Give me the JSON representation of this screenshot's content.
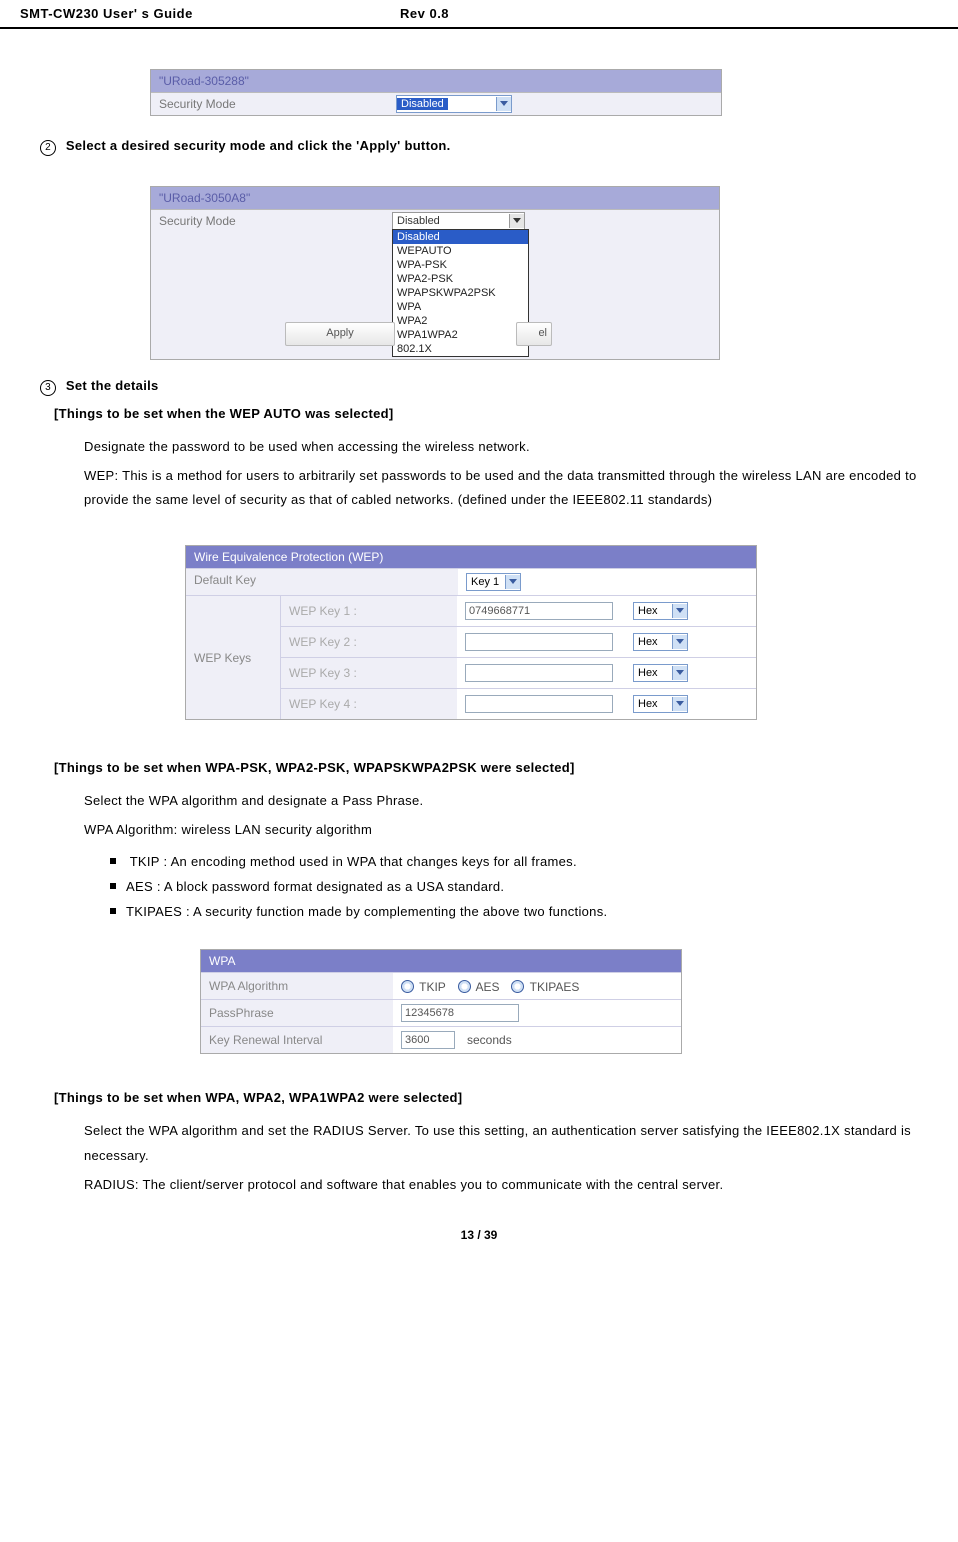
{
  "header": {
    "title_left": "SMT-CW230 User' s Guide",
    "title_mid": "Rev 0.8"
  },
  "embed1": {
    "ssid": "\"URoad-305288\"",
    "label_security_mode": "Security Mode",
    "value": "Disabled"
  },
  "step2_text": "Select a desired security mode and click the  'Apply'  button.",
  "step2_num": "2",
  "embed2": {
    "ssid": "\"URoad-3050A8\"",
    "label": "Security Mode",
    "selected_text": "Disabled",
    "options": [
      "Disabled",
      "WEPAUTO",
      "WPA-PSK",
      "WPA2-PSK",
      "WPAPSKWPA2PSK",
      "WPA",
      "WPA2",
      "WPA1WPA2",
      "802.1X"
    ],
    "highlight_index": 0,
    "apply_label": "Apply",
    "cancel_label_visible_fragment": "el"
  },
  "step3_num": "3",
  "step3_text": "Set the details",
  "wep_heading": "[Things to be set when the WEP AUTO was selected]",
  "wep_p1": "Designate the password to be used when accessing the wireless network.",
  "wep_p2": "WEP: This is a method for users to arbitrarily set passwords to be used and the data transmitted through the wireless LAN are encoded to provide the same level of security as that of cabled networks. (defined under the IEEE802.11 standards)",
  "embed3": {
    "title": "Wire Equivalence Protection (WEP)",
    "defaultkey_label": "Default Key",
    "defaultkey_value": "Key 1",
    "row_label": "WEP Keys",
    "keys": [
      {
        "label": "WEP Key 1 :",
        "value": "0749668771",
        "type": "Hex"
      },
      {
        "label": "WEP Key 2 :",
        "value": "",
        "type": "Hex"
      },
      {
        "label": "WEP Key 3 :",
        "value": "",
        "type": "Hex"
      },
      {
        "label": "WEP Key 4 :",
        "value": "",
        "type": "Hex"
      }
    ]
  },
  "wpa_heading": "[Things to be set when WPA-PSK, WPA2-PSK, WPAPSKWPA2PSK were selected]",
  "wpa_p1": "Select the WPA algorithm and designate a Pass Phrase.",
  "wpa_p2": "WPA Algorithm: wireless LAN security algorithm",
  "bullets": {
    "tkip_prefix": "TKIP : An encoding method used in WPA",
    "tkip_rest": " that changes keys for all frames.",
    "aes": "AES : A block password format designated as a USA standard.",
    "tkipaes": "TKIPAES : A security function made by complementing the above two functions."
  },
  "embed4": {
    "title": "WPA",
    "algo_label": "WPA Algorithm",
    "algo_opts": [
      "TKIP",
      "AES",
      "TKIPAES"
    ],
    "pass_label": "PassPhrase",
    "pass_value": "12345678",
    "renew_label": "Key Renewal Interval",
    "renew_value": "3600",
    "renew_unit": "seconds"
  },
  "wpa2_heading": "[Things to be set when WPA, WPA2, WPA1WPA2 were selected]",
  "wpa2_p1": "Select the WPA algorithm and set the RADIUS Server. To use this setting, an authentication server satisfying the IEEE802.1X standard is necessary.",
  "wpa2_p2": "RADIUS: The client/server protocol and software that enables you to communicate with the central server.",
  "footer": "13 / 39"
}
